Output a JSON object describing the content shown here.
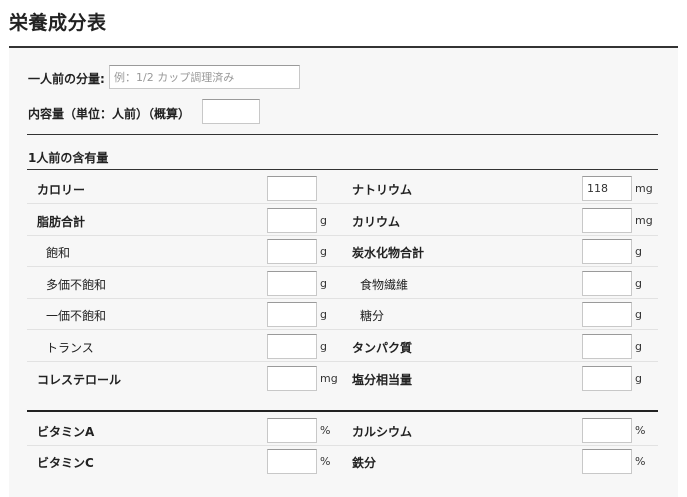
{
  "page": {
    "title": "栄養成分表"
  },
  "serving": {
    "size_label": "一人前の分量:",
    "size_value": "",
    "size_placeholder": "例：1/2 カップ調理済み",
    "count_label": "内容量（単位：人前）（概算）",
    "count_value": ""
  },
  "section_title": "1人前の含有量",
  "left_rows": [
    {
      "label": "カロリー",
      "value": "",
      "unit": ""
    },
    {
      "label": "脂肪合計",
      "value": "",
      "unit": "g"
    },
    {
      "label": "飽和",
      "value": "",
      "unit": "g"
    },
    {
      "label": "多価不飽和",
      "value": "",
      "unit": "g"
    },
    {
      "label": "一価不飽和",
      "value": "",
      "unit": "g"
    },
    {
      "label": "トランス",
      "value": "",
      "unit": "g"
    },
    {
      "label": "コレステロール",
      "value": "",
      "unit": "mg"
    }
  ],
  "right_rows": [
    {
      "label": "ナトリウム",
      "value": "118",
      "unit": "mg"
    },
    {
      "label": "カリウム",
      "value": "",
      "unit": "mg"
    },
    {
      "label": "炭水化物合計",
      "value": "",
      "unit": "g"
    },
    {
      "label": "食物繊維",
      "value": "",
      "unit": "g"
    },
    {
      "label": "糖分",
      "value": "",
      "unit": "g"
    },
    {
      "label": "タンパク質",
      "value": "",
      "unit": "g"
    },
    {
      "label": "塩分相当量",
      "value": "",
      "unit": "g"
    }
  ],
  "vitamins_left": [
    {
      "label": "ビタミンA",
      "value": "",
      "unit": "%"
    },
    {
      "label": "ビタミンC",
      "value": "",
      "unit": "%"
    }
  ],
  "vitamins_right": [
    {
      "label": "カルシウム",
      "value": "",
      "unit": "%"
    },
    {
      "label": "鉄分",
      "value": "",
      "unit": "%"
    }
  ]
}
